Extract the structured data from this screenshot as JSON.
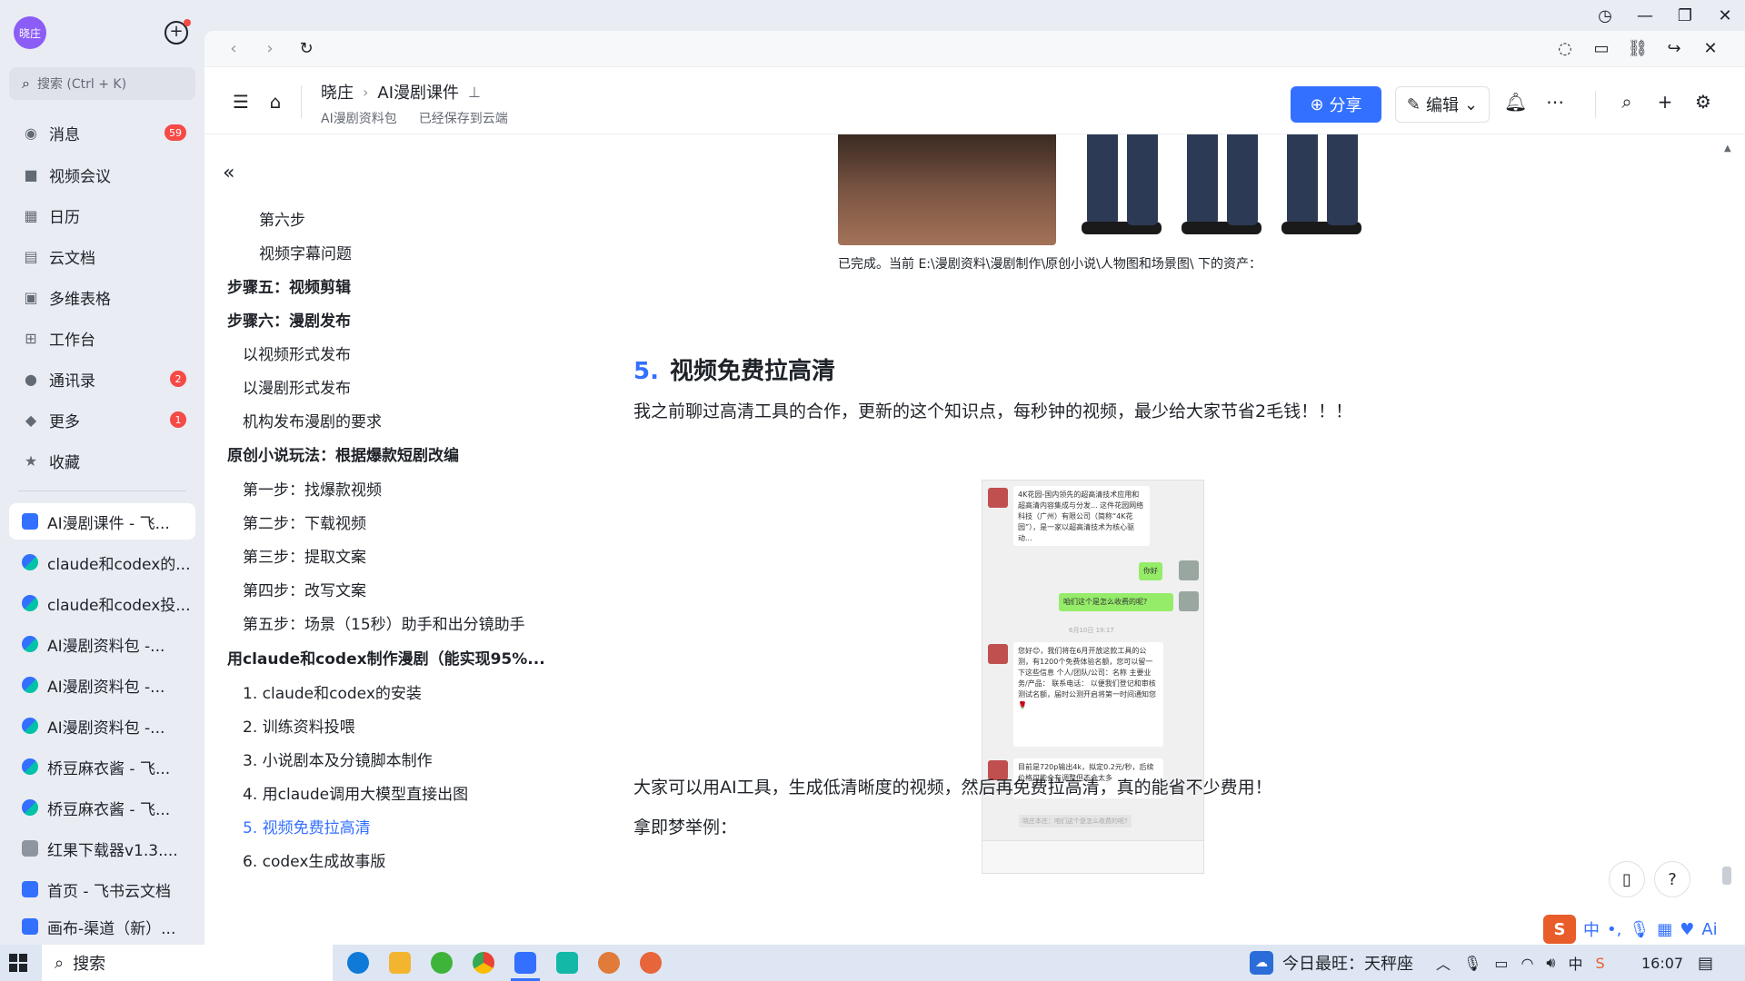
{
  "sidebar": {
    "avatar_text": "晓庄",
    "search_placeholder": "搜索 (Ctrl + K)",
    "nav": [
      {
        "label": "消息",
        "badge": "59",
        "icon": "chat-bubble-icon"
      },
      {
        "label": "视频会议",
        "badge": "",
        "icon": "video-camera-icon"
      },
      {
        "label": "日历",
        "badge": "",
        "icon": "calendar-icon"
      },
      {
        "label": "云文档",
        "badge": "",
        "icon": "cloud-doc-icon"
      },
      {
        "label": "多维表格",
        "badge": "",
        "icon": "table-icon"
      },
      {
        "label": "工作台",
        "badge": "",
        "icon": "grid-apps-icon"
      },
      {
        "label": "通讯录",
        "badge": "2",
        "icon": "contacts-icon"
      },
      {
        "label": "更多",
        "badge": "1",
        "icon": "more-apps-icon"
      },
      {
        "label": "收藏",
        "badge": "",
        "icon": "star-icon"
      }
    ],
    "docs": [
      {
        "label": "AI漫剧课件 - 飞...",
        "type": "doc"
      },
      {
        "label": "claude和codex的...",
        "type": "wiki"
      },
      {
        "label": "claude和codex投...",
        "type": "wiki"
      },
      {
        "label": "AI漫剧资料包 -...",
        "type": "wiki"
      },
      {
        "label": "AI漫剧资料包 -...",
        "type": "wiki"
      },
      {
        "label": "AI漫剧资料包 -...",
        "type": "wiki"
      },
      {
        "label": "桥豆麻衣酱 - 飞...",
        "type": "wiki"
      },
      {
        "label": "桥豆麻衣酱 - 飞...",
        "type": "wiki"
      },
      {
        "label": "红果下载器v1.3....",
        "type": "file"
      },
      {
        "label": "首页 - 飞书云文档",
        "type": "doc"
      },
      {
        "label": "画布-渠道（新）...",
        "type": "doc"
      }
    ]
  },
  "header": {
    "crumb_root": "晓庄",
    "crumb_doc": "AI漫剧课件",
    "sub_folder": "AI漫剧资料包",
    "save_status": "已经保存到云端",
    "share_label": "分享",
    "edit_label": "编辑"
  },
  "outline": {
    "items": [
      {
        "label": "第六步",
        "level": 3,
        "current": false
      },
      {
        "label": "视频字幕问题",
        "level": 3,
        "current": false
      },
      {
        "label": "步骤五：视频剪辑",
        "level": 1,
        "current": false
      },
      {
        "label": "步骤六：漫剧发布",
        "level": 1,
        "current": false
      },
      {
        "label": "以视频形式发布",
        "level": 2,
        "current": false
      },
      {
        "label": "以漫剧形式发布",
        "level": 2,
        "current": false
      },
      {
        "label": "机构发布漫剧的要求",
        "level": 2,
        "current": false
      },
      {
        "label": "原创小说玩法：根据爆款短剧改编",
        "level": 1,
        "current": false
      },
      {
        "label": "第一步：找爆款视频",
        "level": 2,
        "current": false
      },
      {
        "label": "第二步：下载视频",
        "level": 2,
        "current": false
      },
      {
        "label": "第三步：提取文案",
        "level": 2,
        "current": false
      },
      {
        "label": "第四步：改写文案",
        "level": 2,
        "current": false
      },
      {
        "label": "第五步：场景（15秒）助手和出分镜助手",
        "level": 2,
        "current": false
      },
      {
        "label": "用claude和codex制作漫剧（能实现95%...",
        "level": 1,
        "current": false
      },
      {
        "label": "1. claude和codex的安装",
        "level": 2,
        "current": false
      },
      {
        "label": "2. 训练资料投喂",
        "level": 2,
        "current": false
      },
      {
        "label": "3. 小说剧本及分镜脚本制作",
        "level": 2,
        "current": false
      },
      {
        "label": "4. 用claude调用大模型直接出图",
        "level": 2,
        "current": false
      },
      {
        "label": "5. 视频免费拉高清",
        "level": 2,
        "current": true
      },
      {
        "label": "6. codex生成故事版",
        "level": 2,
        "current": false
      }
    ]
  },
  "content": {
    "image_caption": "已完成。当前 E:\\漫剧资料\\漫剧制作\\原创小说\\人物图和场景图\\ 下的资产：",
    "heading_num": "5.",
    "heading_text": "视频免费拉高清",
    "para1": "我之前聊过高清工具的合作，更新的这个知识点，每秒钟的视频，最少给大家节省2毛钱！！！",
    "para2": "大家可以用AI工具，生成低清晰度的视频，然后再免费拉高清，真的能省不少费用！",
    "para3": "拿即梦举例："
  },
  "chat": {
    "card_text": "4K花园-国内领先的超高清技术应用和超高清内容集成与分发... 这件花园网络科技（广州）有限公司（简称“4K花园”），是一家以超高清技术为核心驱动...",
    "msg_hello": "你好",
    "msg_ask": "咱们这个是怎么收费的呢?",
    "time": "6月10日 19:17",
    "msg_reply": "您好😊，我们将在6月开放这款工具的公测，有1200个免费体验名额，您可以留一下这些信息 个人/团队/公司：名称 主要业务/产品： 联系电话： 以便我们登记和审核测试名额，届时公测开启将第一时间通知您🌹",
    "msg_price": "目前是720p输出4k，拟定0.2元/秒，后续价格可能会有调整但不会太多",
    "msg_quote": "晓庄本庄：咱们这个是怎么收费的呢?"
  },
  "ime": {
    "lang": "中",
    "label": "Ai"
  },
  "taskbar": {
    "search_label": "搜索",
    "weather": "今日最旺：天秤座",
    "time": "16:07"
  },
  "colors": {
    "accent": "#3370ff",
    "badge": "#f54a45",
    "sidebar_bg": "#e9ecf3"
  }
}
